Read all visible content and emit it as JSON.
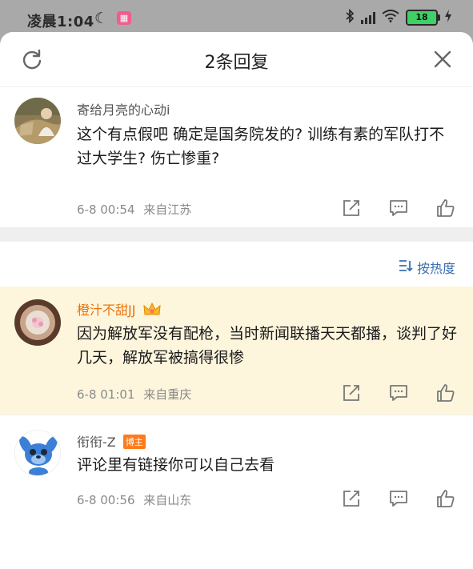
{
  "status_bar": {
    "time": "凌晨1:04",
    "battery": "18",
    "app_badge": "🎂"
  },
  "header": {
    "title": "2条回复"
  },
  "root_comment": {
    "username": "寄给月亮的心动i",
    "text": "这个有点假吧 确定是国务院发的? 训练有素的军队打不过大学生? 伤亡惨重?",
    "date": "6-8 00:54",
    "location": "来自江苏"
  },
  "sort": {
    "label": "按热度"
  },
  "replies": [
    {
      "username": "橙汁不甜JJ",
      "text": "因为解放军没有配枪，当时新闻联播天天都播，谈判了好几天，解放军被搞得很惨",
      "date": "6-8 01:01",
      "location": "来自重庆",
      "highlighted": true
    },
    {
      "username": "衔衔-Z",
      "badge": "博主",
      "text": "评论里有链接你可以自己去看",
      "date": "6-8 00:56",
      "location": "来自山东",
      "highlighted": false
    }
  ],
  "colors": {
    "highlight_bg": "#fdf6dd",
    "vip_name": "#e8730c",
    "link_blue": "#3a6fb3",
    "blogger_badge": "#ff7a1a"
  },
  "icons": [
    "refresh-icon",
    "close-icon",
    "share-icon",
    "comment-icon",
    "like-icon",
    "sort-icon",
    "crown-icon"
  ]
}
